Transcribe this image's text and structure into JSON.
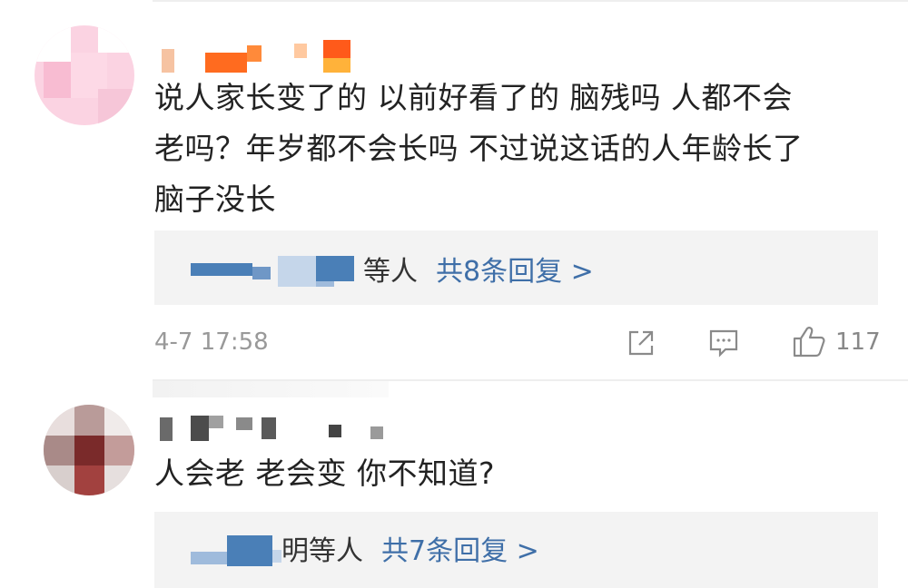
{
  "comments": [
    {
      "text_lines": [
        "说人家长变了的 以前好看了的  脑残吗 人都不会",
        "老吗？年岁都不会长吗 不过说这话的人年龄长了",
        "脑子没长"
      ],
      "replies": {
        "suffix": "等人",
        "link": "共8条回复 >"
      },
      "time": "4-7 17:58",
      "like_count": "117",
      "colors": {
        "username_a": "#ff8a3a",
        "username_b": "#ff5a1a"
      }
    },
    {
      "text": "人会老 老会变 你不知道?",
      "replies": {
        "suffix": "明等人",
        "link": "共7条回复 >"
      }
    }
  ],
  "icons": {
    "share": "share-icon",
    "comment": "comment-icon",
    "like": "like-icon"
  },
  "colors": {
    "link": "#3f6fa8",
    "reply_bg": "#f3f3f3",
    "muted": "#999999"
  }
}
